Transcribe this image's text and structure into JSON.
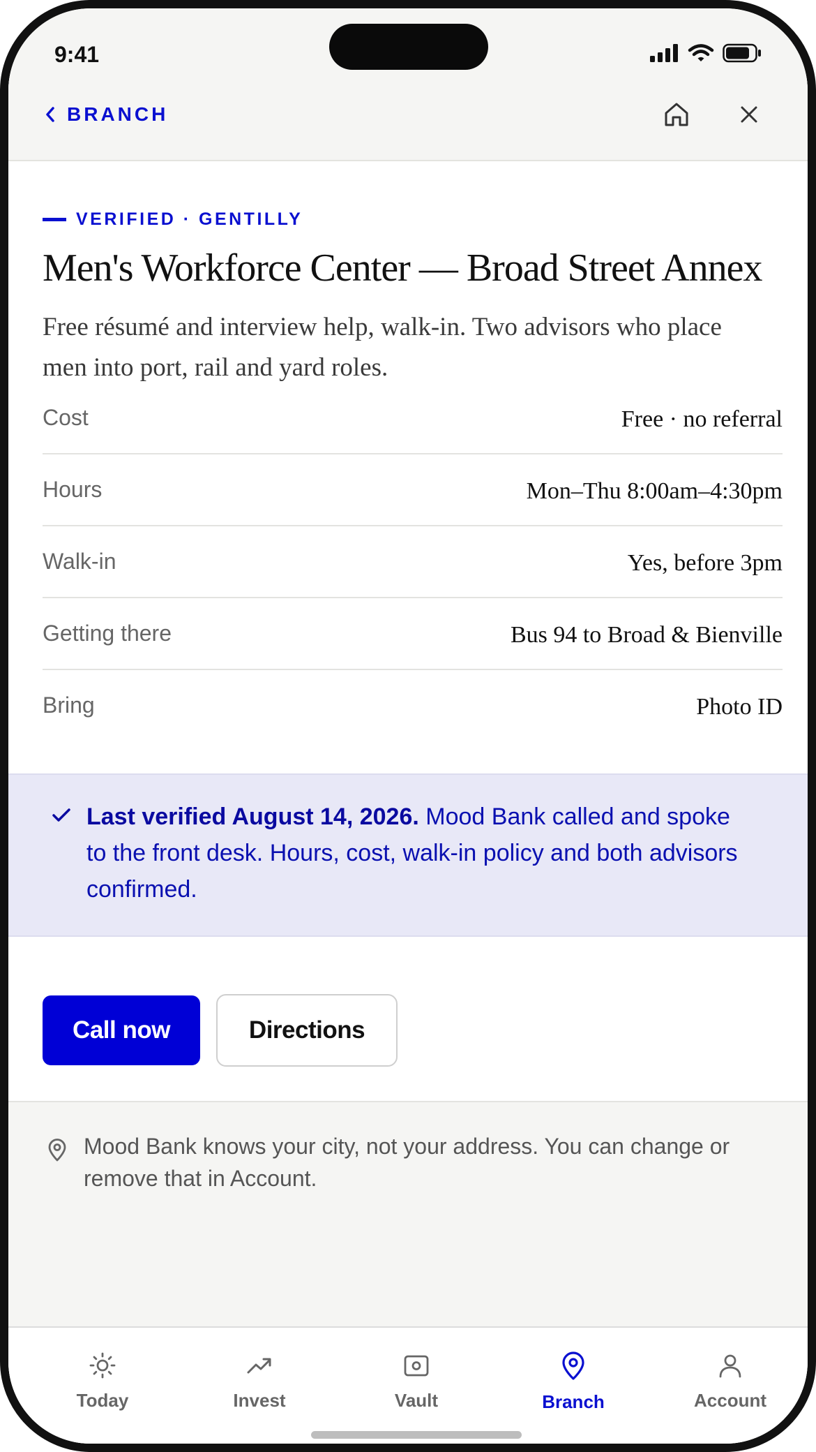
{
  "status_bar": {
    "time": "9:41"
  },
  "nav": {
    "back_label": "BRANCH"
  },
  "listing": {
    "eyebrow": "VERIFIED · GENTILLY",
    "title": "Men's Workforce Center — Broad Street Annex",
    "description": "Free résumé and interview help, walk-in. Two advisors who place men into port, rail and yard roles.",
    "details": [
      {
        "label": "Cost",
        "value": "Free · no referral"
      },
      {
        "label": "Hours",
        "value": "Mon–Thu 8:00am–4:30pm"
      },
      {
        "label": "Walk-in",
        "value": "Yes, before 3pm"
      },
      {
        "label": "Getting there",
        "value": "Bus 94 to Broad & Bienville"
      },
      {
        "label": "Bring",
        "value": "Photo ID"
      }
    ]
  },
  "verification": {
    "bold": "Last verified August 14, 2026.",
    "text": " Mood Bank called and spoke to the front desk. Hours, cost, walk-in policy and both advisors confirmed."
  },
  "actions": {
    "call_label": "Call now",
    "directions_label": "Directions"
  },
  "privacy": {
    "text": "Mood Bank knows your city, not your address. You can change or remove that in Account."
  },
  "tabs": [
    {
      "label": "Today",
      "icon": "sun-icon",
      "active": false
    },
    {
      "label": "Invest",
      "icon": "trend-up-icon",
      "active": false
    },
    {
      "label": "Vault",
      "icon": "vault-icon",
      "active": false
    },
    {
      "label": "Branch",
      "icon": "location-pin-icon",
      "active": true
    },
    {
      "label": "Account",
      "icon": "person-icon",
      "active": false
    }
  ],
  "colors": {
    "accent": "#0000d6",
    "accent_text": "#0a10d0",
    "verified_bg": "#e8e8f7",
    "surface": "#f5f5f3"
  }
}
